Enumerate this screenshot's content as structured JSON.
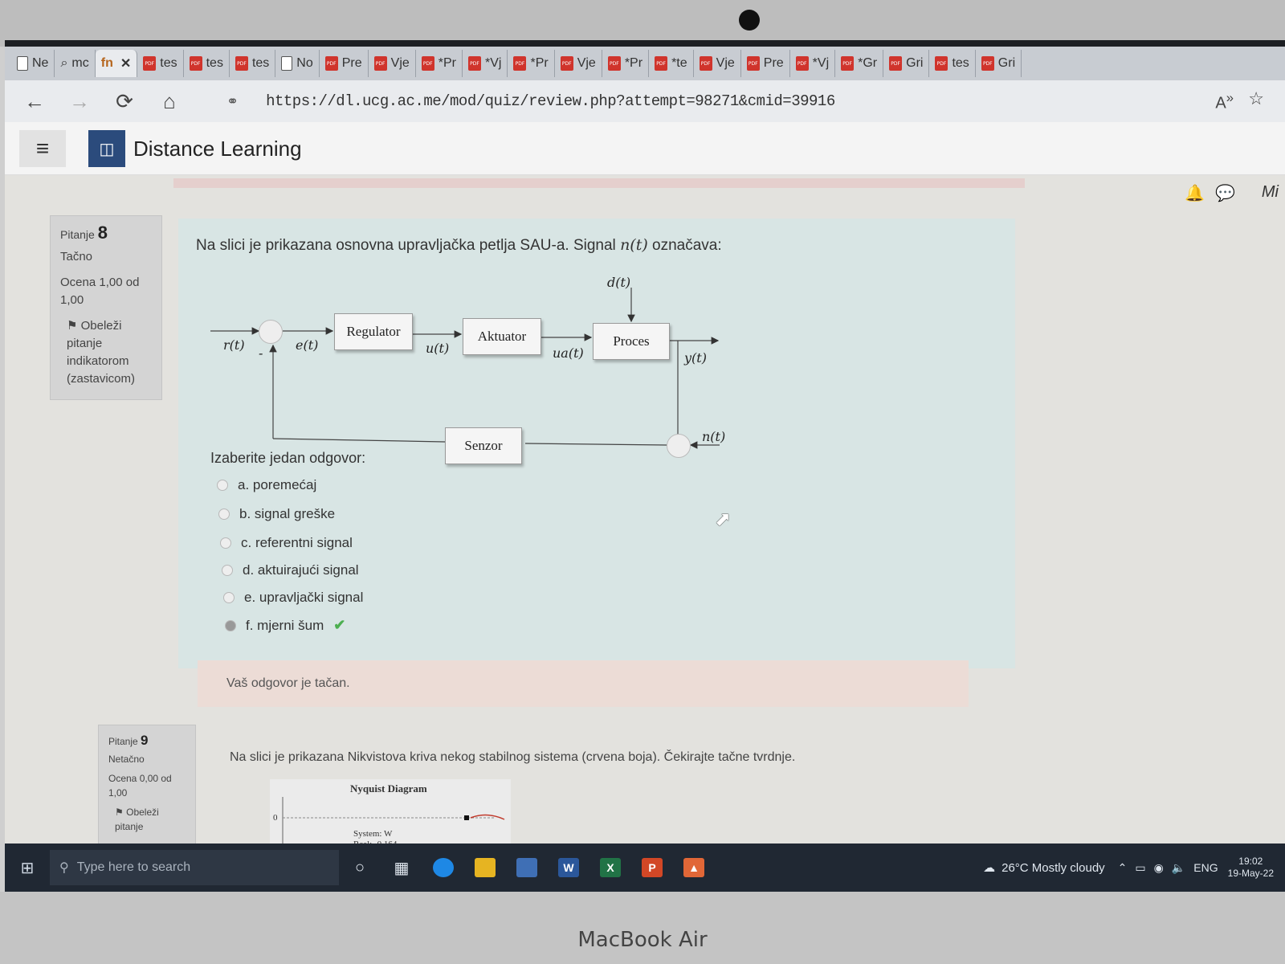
{
  "browser": {
    "tabs": [
      {
        "label": "Ne",
        "icon": "page"
      },
      {
        "label": "mc",
        "icon": "search"
      },
      {
        "label": "",
        "icon": "moodle",
        "active": true
      },
      {
        "label": "tes",
        "icon": "pdf"
      },
      {
        "label": "tes",
        "icon": "pdf"
      },
      {
        "label": "tes",
        "icon": "pdf"
      },
      {
        "label": "No",
        "icon": "page"
      },
      {
        "label": "Pre",
        "icon": "pdf"
      },
      {
        "label": "Vje",
        "icon": "pdf"
      },
      {
        "label": "*Pr",
        "icon": "pdf"
      },
      {
        "label": "*Vj",
        "icon": "pdf"
      },
      {
        "label": "*Pr",
        "icon": "pdf"
      },
      {
        "label": "Vje",
        "icon": "pdf"
      },
      {
        "label": "*Pr",
        "icon": "pdf"
      },
      {
        "label": "*te",
        "icon": "pdf"
      },
      {
        "label": "Vje",
        "icon": "pdf"
      },
      {
        "label": "Pre",
        "icon": "pdf"
      },
      {
        "label": "*Vj",
        "icon": "pdf"
      },
      {
        "label": "*Gr",
        "icon": "pdf"
      },
      {
        "label": "Gri",
        "icon": "pdf"
      },
      {
        "label": "tes",
        "icon": "pdf"
      },
      {
        "label": "Gri",
        "icon": "pdf"
      }
    ],
    "active_tab_glyph": "fn",
    "close_glyph": "✕",
    "url": "https://dl.ucg.ac.me/mod/quiz/review.php?attempt=98271&cmid=39916",
    "icons": {
      "back": "←",
      "forward": "→",
      "reload": "⟳",
      "home": "⌂",
      "lock": "🔒",
      "read_aloud": "A",
      "favorites": "☆"
    }
  },
  "moodle": {
    "site_name": "Distance Learning",
    "user_abbr": "Mi",
    "menu_glyph": "≡"
  },
  "question8": {
    "number_label": "Pitanje",
    "number": "8",
    "status": "Tačno",
    "grade_line1": "Ocena 1,00 od",
    "grade_line2": "1,00",
    "flag_lines": [
      "Obeleži",
      "pitanje",
      "indikatorom",
      "(zastavicom)"
    ],
    "text_before": "Na slici je prikazana osnovna upravljačka petlja SAU-a. Signal ",
    "text_signal": "n(t)",
    "text_after": " označava:",
    "prompt": "Izaberite jedan odgovor:",
    "options": [
      "a. poremećaj",
      "b. signal greške",
      "c. referentni signal",
      "d. aktuirajući signal",
      "e. upravljački signal",
      "f. mjerni šum"
    ],
    "correct_mark": "✔",
    "feedback": "Vaš odgovor je tačan."
  },
  "diagram": {
    "blocks": {
      "regulator": "Regulator",
      "aktuator": "Aktuator",
      "proces": "Proces",
      "senzor": "Senzor"
    },
    "labels": {
      "r": "r(t)",
      "e": "e(t)",
      "u": "u(t)",
      "ua": "ua(t)",
      "y": "y(t)",
      "d": "d(t)",
      "n": "n(t)",
      "minus": "-"
    }
  },
  "question9": {
    "number_label": "Pitanje",
    "number": "9",
    "status": "Netačno",
    "grade_line1": "Ocena 0,00 od",
    "grade_line2": "1,00",
    "flag_lines": [
      "Obeleži",
      "pitanje"
    ],
    "text": "Na slici je prikazana Nikvistova kriva nekog stabilnog sistema (crvena boja). Čekirajte tačne tvrdnje.",
    "chart_title": "Nyquist Diagram",
    "axis_zero": "0",
    "tooltip_line1": "System: W",
    "tooltip_line2": "Real: -0.164"
  },
  "taskbar": {
    "search_placeholder": "Type here to search",
    "weather": "26°C  Mostly cloudy",
    "lang": "ENG",
    "time": "19:02",
    "date": "19-May-22",
    "apps": [
      "circle",
      "task-view",
      "edge",
      "explorer",
      "store",
      "word",
      "excel",
      "powerpoint",
      "matlab"
    ]
  },
  "brand": "MacBook Air",
  "colors": {
    "pdf": "#d0342c",
    "logo": "#2b4b7c",
    "check": "#4caf50",
    "question_bg": "#d8e5e4",
    "feedback_bg": "#ecdcd6"
  }
}
